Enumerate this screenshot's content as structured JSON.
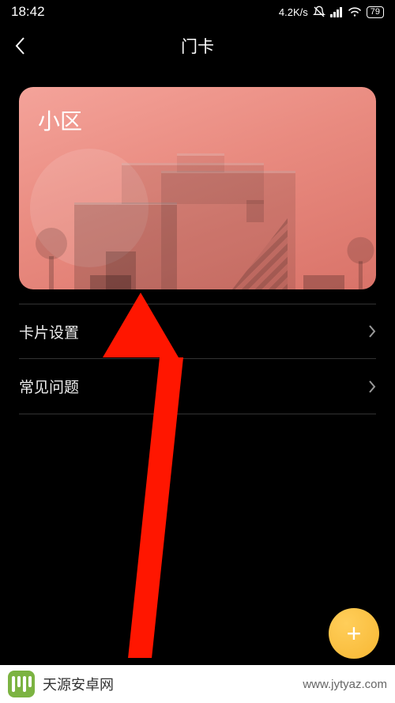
{
  "status": {
    "time": "18:42",
    "speed": "4.2K/s",
    "battery": "79"
  },
  "header": {
    "title": "门卡"
  },
  "card": {
    "label": "小区"
  },
  "list": {
    "items": [
      {
        "label": "卡片设置"
      },
      {
        "label": "常见问题"
      }
    ]
  },
  "fab": {
    "plus": "+"
  },
  "watermark": {
    "brand": "天源安卓网",
    "url": "www.jytyaz.com"
  }
}
